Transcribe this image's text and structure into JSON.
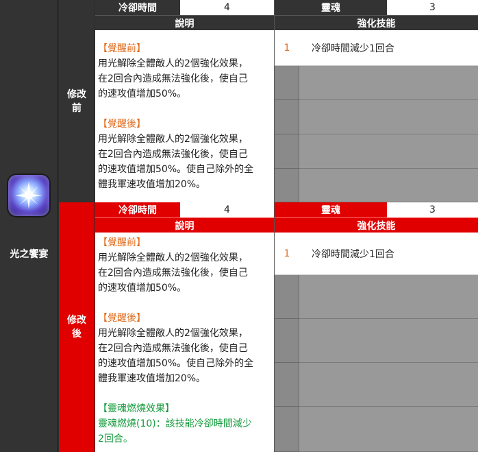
{
  "skill": {
    "name": "光之饗宴",
    "icon": "light-burst-icon"
  },
  "before": {
    "label": "修改前",
    "cooldown_label": "冷卻時間",
    "cooldown_value": "4",
    "soul_label": "靈魂",
    "soul_value": "3",
    "desc_header": "說明",
    "enhance_header": "強化技能",
    "desc": {
      "pre_title": "【覺醒前】",
      "pre_text": [
        "用光解除全體敵人的2個強化效果，",
        "在2回合內造成無法強化後，使自己",
        "的速攻值增加50%。"
      ],
      "post_title": "【覺醒後】",
      "post_text": [
        "用光解除全體敵人的2個強化效果，",
        "在2回合內造成無法強化後，使自己",
        "的速攻值增加50%。使自己除外的全",
        "體我軍速攻值增加20%。"
      ]
    },
    "enhance": [
      {
        "level": "1",
        "text": "冷卻時間減少1回合"
      }
    ]
  },
  "after": {
    "label": "修改後",
    "cooldown_label": "冷卻時間",
    "cooldown_value": "4",
    "soul_label": "靈魂",
    "soul_value": "3",
    "desc_header": "說明",
    "enhance_header": "強化技能",
    "desc": {
      "pre_title": "【覺醒前】",
      "pre_text": [
        "用光解除全體敵人的2個強化效果，",
        "在2回合內造成無法強化後，使自己",
        "的速攻值增加50%。"
      ],
      "post_title": "【覺醒後】",
      "post_text": [
        "用光解除全體敵人的2個強化效果，",
        "在2回合內造成無法強化後，使自己",
        "的速攻值增加50%。使自己除外的全",
        "體我軍速攻值增加20%。"
      ],
      "soul_title": "【靈魂燃燒效果】",
      "soul_text": [
        "靈魂燃燒(10)：該技能冷卻時間減少",
        "2回合。"
      ]
    },
    "enhance": [
      {
        "level": "1",
        "text": "冷卻時間減少1回合"
      }
    ]
  },
  "colors": {
    "accent_red": "#e00000",
    "header_dark": "#333333",
    "orange": "#e06a1a",
    "green": "#129a3a"
  }
}
